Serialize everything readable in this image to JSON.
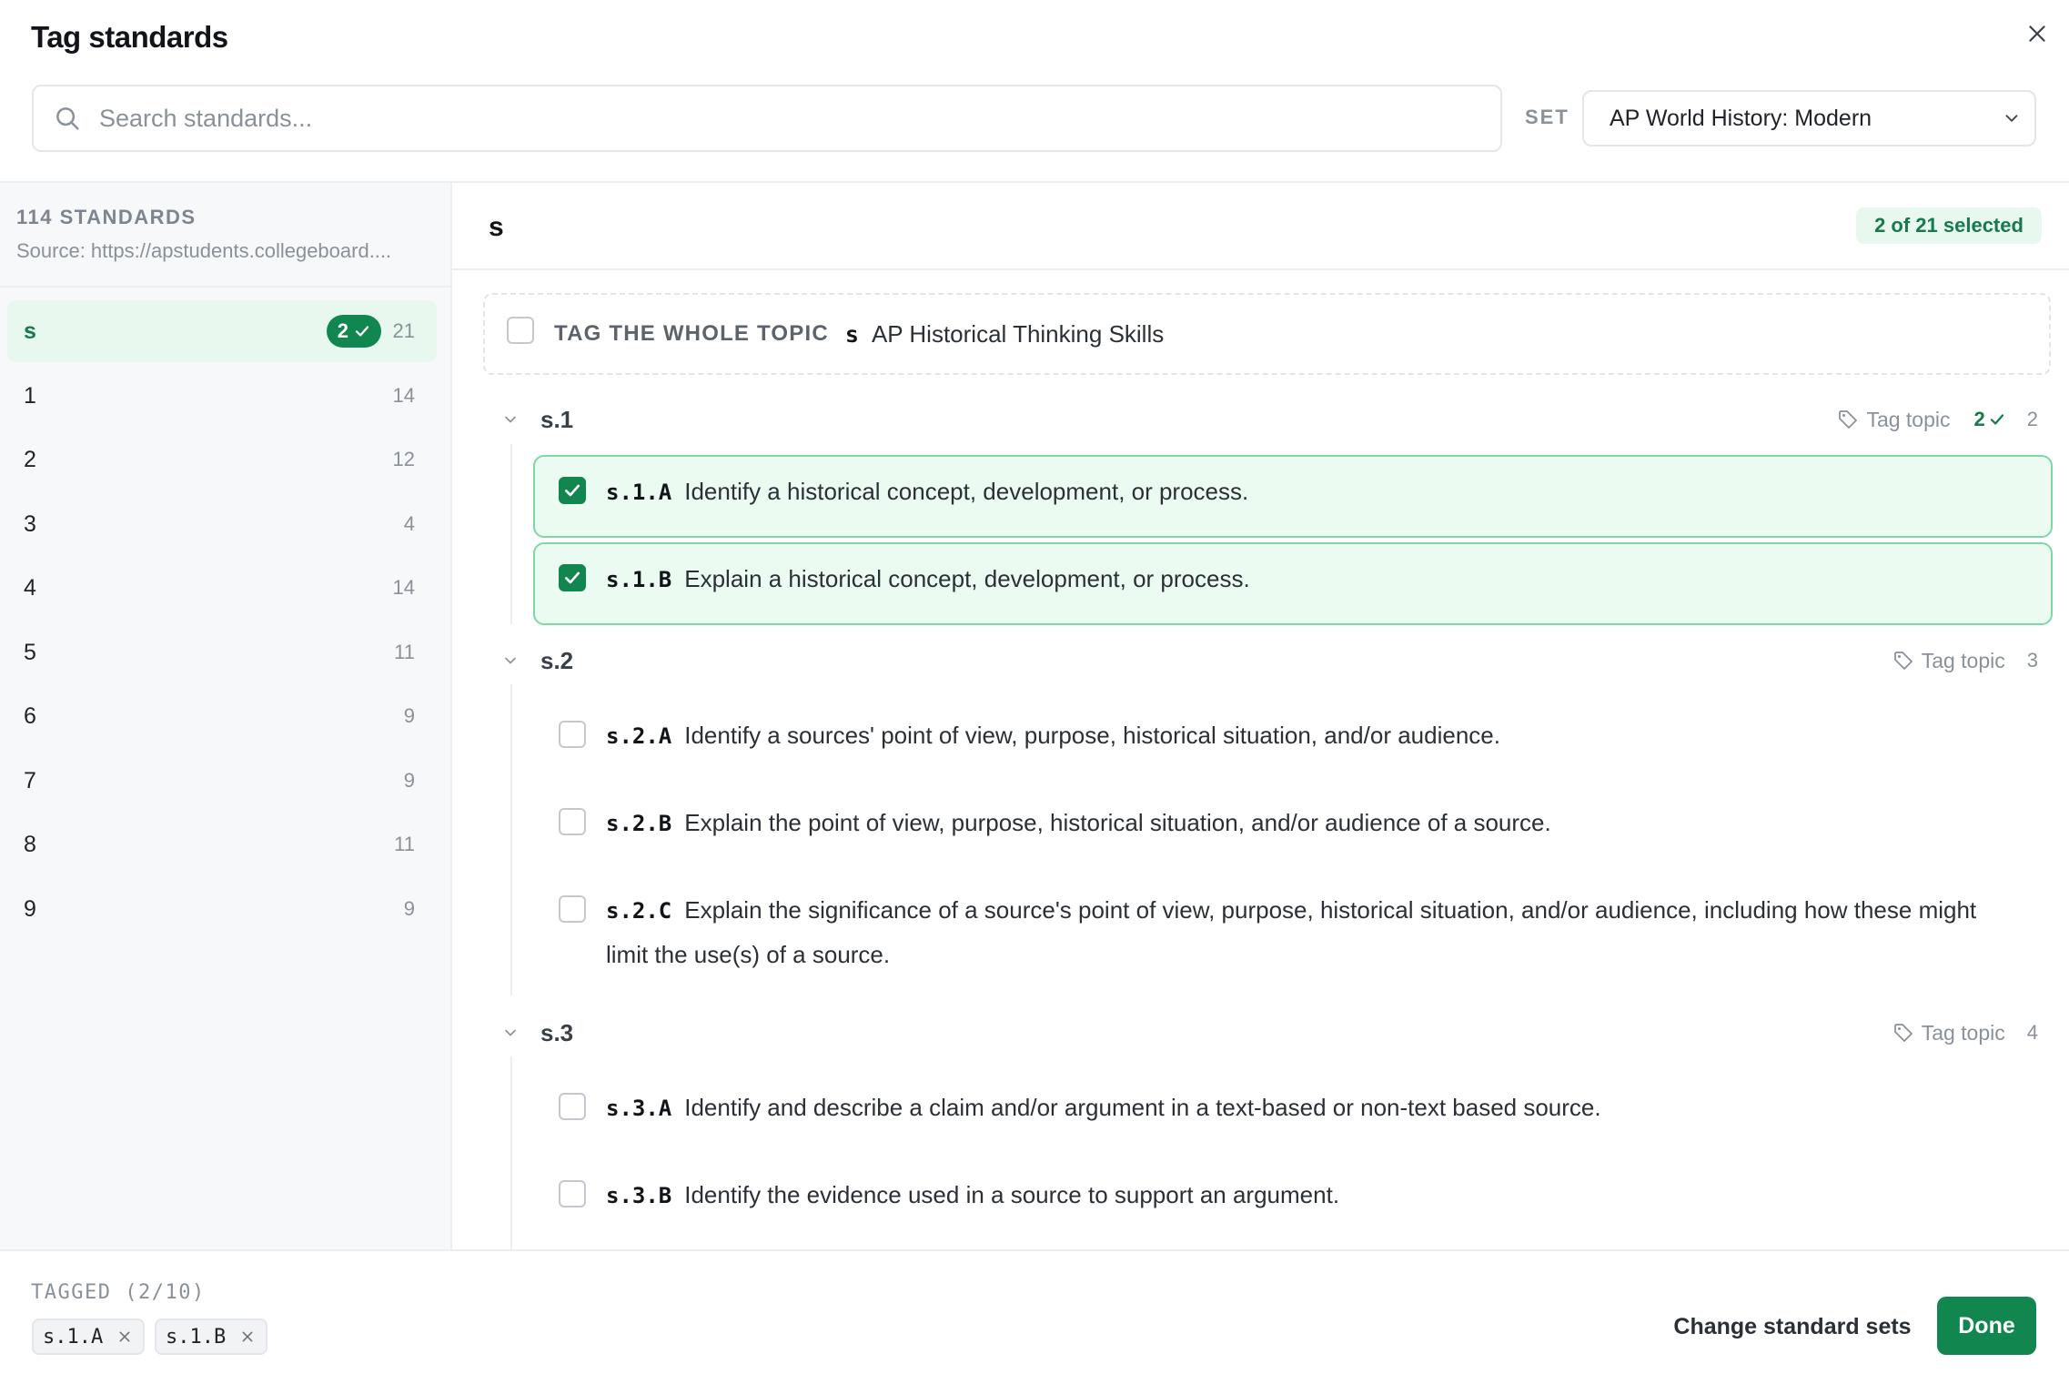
{
  "dialog": {
    "title": "Tag standards"
  },
  "search": {
    "placeholder": "Search standards..."
  },
  "set": {
    "label": "SET",
    "selected": "AP World History: Modern"
  },
  "sidebar": {
    "count_label": "114 STANDARDS",
    "source": "Source: https://apstudents.collegeboard....",
    "items": [
      {
        "label": "s",
        "selected": "2",
        "count": "21",
        "active": true
      },
      {
        "label": "1",
        "count": "14"
      },
      {
        "label": "2",
        "count": "12"
      },
      {
        "label": "3",
        "count": "4"
      },
      {
        "label": "4",
        "count": "14"
      },
      {
        "label": "5",
        "count": "11"
      },
      {
        "label": "6",
        "count": "9"
      },
      {
        "label": "7",
        "count": "9"
      },
      {
        "label": "8",
        "count": "11"
      },
      {
        "label": "9",
        "count": "9"
      }
    ]
  },
  "main": {
    "title": "s",
    "selected_summary": "2 of 21 selected",
    "whole_topic": {
      "label": "TAG THE WHOLE TOPIC",
      "code": "s",
      "name": "AP Historical Thinking Skills",
      "checked": false
    },
    "tag_topic_label": "Tag topic",
    "groups": [
      {
        "code": "s.1",
        "selected": "2",
        "total": "2",
        "standards": [
          {
            "code": "s.1.A",
            "text": "Identify a historical concept, development, or process.",
            "checked": true
          },
          {
            "code": "s.1.B",
            "text": "Explain a historical concept, development, or process.",
            "checked": true
          }
        ]
      },
      {
        "code": "s.2",
        "total": "3",
        "standards": [
          {
            "code": "s.2.A",
            "text": "Identify a sources' point of view, purpose, historical situation, and/or audience.",
            "checked": false
          },
          {
            "code": "s.2.B",
            "text": "Explain the point of view, purpose, historical situation, and/or audience of a source.",
            "checked": false
          },
          {
            "code": "s.2.C",
            "text": "Explain the significance of a source's point of view, purpose, historical situation, and/or audience, including how these might limit the use(s) of a source.",
            "checked": false
          }
        ]
      },
      {
        "code": "s.3",
        "total": "4",
        "standards": [
          {
            "code": "s.3.A",
            "text": "Identify and describe a claim and/or argument in a text-based or non-text based source.",
            "checked": false
          },
          {
            "code": "s.3.B",
            "text": "Identify the evidence used in a source to support an argument.",
            "checked": false
          }
        ]
      }
    ]
  },
  "footer": {
    "tagged_label": "TAGGED (2/10)",
    "chips": [
      "s.1.A",
      "s.1.B"
    ],
    "change_button": "Change standard sets",
    "done_button": "Done"
  },
  "colors": {
    "accent": "#12864f",
    "accent_light": "#e8f8ef",
    "accent_text": "#177a4d",
    "selected_border": "#7ed8a6"
  }
}
